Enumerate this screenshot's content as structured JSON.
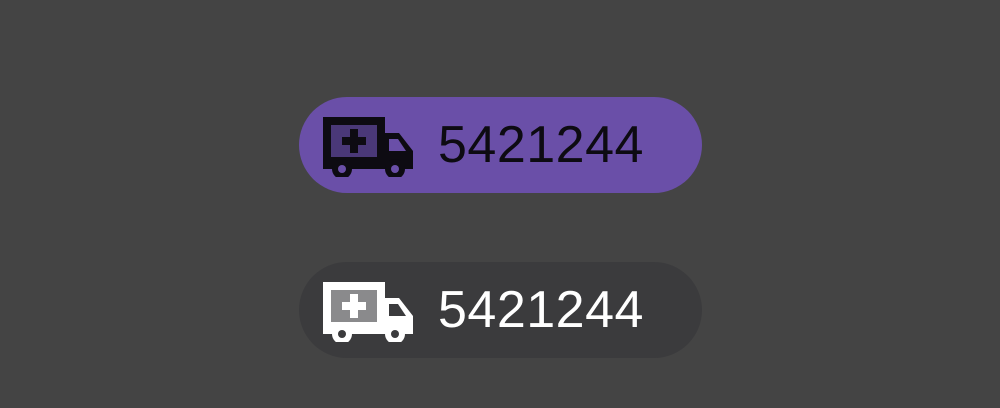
{
  "chips": [
    {
      "label": "5421244",
      "icon": "ambulance-icon",
      "state": "selected",
      "background": "#6a4fa8",
      "foreground": "#0d0b12"
    },
    {
      "label": "5421244",
      "icon": "ambulance-icon",
      "state": "unselected",
      "background": "#3b3b3d",
      "foreground": "#ffffff"
    }
  ],
  "colors": {
    "page_background": "#444444"
  }
}
